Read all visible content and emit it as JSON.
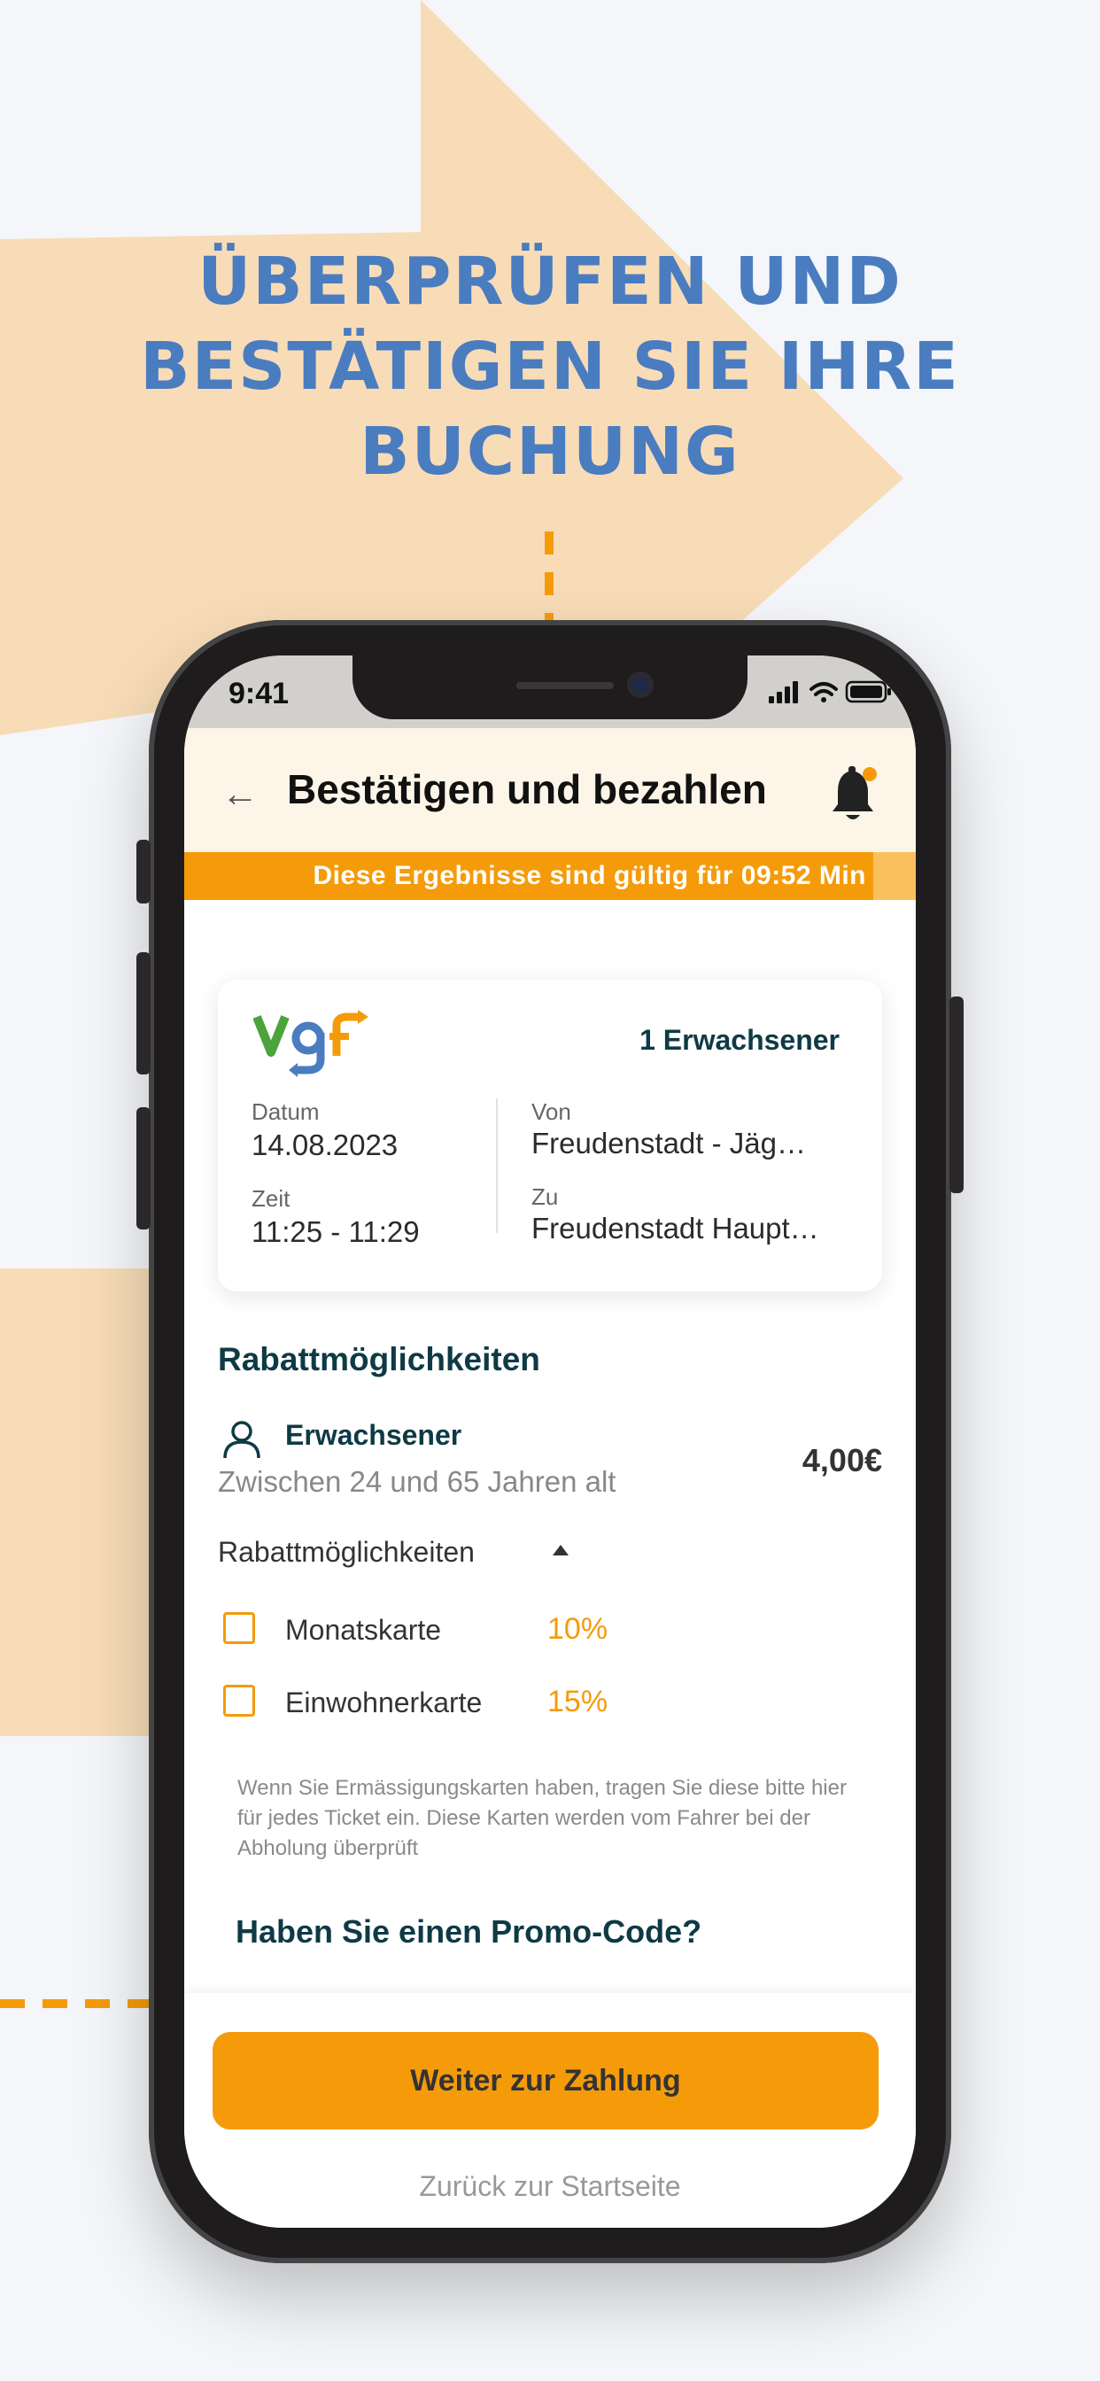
{
  "promo": {
    "headline_lines": [
      "ÜBERPRÜFEN UND",
      "BESTÄTIGEN SIE IHRE",
      "BUCHUNG"
    ]
  },
  "colors": {
    "accent": "#f59b0a",
    "headline": "#4a7cc0",
    "dark_teal": "#0e3a45",
    "background_shape": "#f8dcb7"
  },
  "status_bar": {
    "time": "9:41",
    "icons": [
      "signal-icon",
      "wifi-icon",
      "battery-icon"
    ]
  },
  "header": {
    "back_icon": "back-arrow-icon",
    "title": "Bestätigen und bezahlen",
    "bell_icon": "bell-icon"
  },
  "banner": {
    "text": "Diese Ergebnisse sind gültig für 09:52 Min"
  },
  "ticket": {
    "logo": "vgf",
    "passengers": "1 Erwachsener",
    "date_label": "Datum",
    "date": "14.08.2023",
    "time_label": "Zeit",
    "time": "11:25 - 11:29",
    "from_label": "Von",
    "from": "Freudenstadt - Jäg…",
    "to_label": "Zu",
    "to": "Freudenstadt Haupt…"
  },
  "discounts": {
    "section_title": "Rabattmöglichkeiten",
    "person_icon": "person-icon",
    "passenger_type": "Erwachsener",
    "passenger_age": "Zwischen 24 und 65 Jahren alt",
    "price": "4,00€",
    "toggle_label": "Rabattmöglichkeiten",
    "options": [
      {
        "label": "Monatskarte",
        "percent": "10%"
      },
      {
        "label": "Einwohnerkarte",
        "percent": "15%"
      }
    ],
    "note": "Wenn Sie Ermässigungskarten haben, tragen Sie diese bitte hier für jedes Ticket ein. Diese Karten werden vom Fahrer bei der Abholung überprüft"
  },
  "promo_code": {
    "title": "Haben Sie einen Promo-Code?"
  },
  "actions": {
    "pay_label": "Weiter zur Zahlung",
    "home_label": "Zurück zur Startseite"
  }
}
